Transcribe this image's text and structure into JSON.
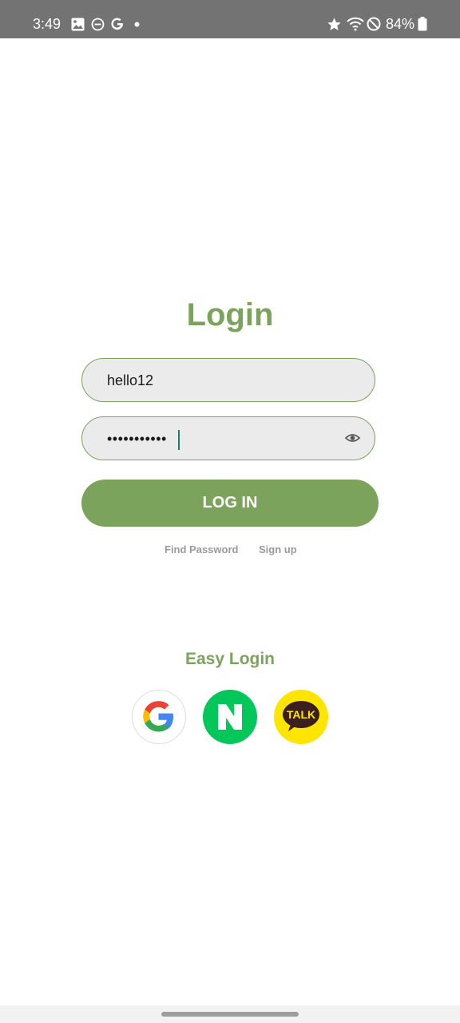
{
  "status_bar": {
    "time": "3:49",
    "battery_percent": "84%",
    "icons": [
      "image-icon",
      "do-not-disturb-icon",
      "google-g-icon",
      "notification-dot-icon",
      "star-icon",
      "wifi-icon",
      "blocked-icon",
      "battery-icon"
    ]
  },
  "login": {
    "title": "Login",
    "username_value": "hello12",
    "password_value": "•••••••••••",
    "button_label": "LOG IN",
    "find_password": "Find Password",
    "sign_up": "Sign up"
  },
  "easy_login": {
    "title": "Easy Login",
    "providers": [
      {
        "name": "google",
        "icon": "google-icon"
      },
      {
        "name": "naver",
        "icon": "naver-icon",
        "label": "N"
      },
      {
        "name": "kakao",
        "icon": "kakao-talk-icon",
        "label": "TALK"
      }
    ]
  },
  "colors": {
    "accent": "#7ba35c",
    "field_bg": "#ebebeb",
    "status_bar": "#737373",
    "naver": "#03c75a",
    "kakao": "#fee500"
  }
}
